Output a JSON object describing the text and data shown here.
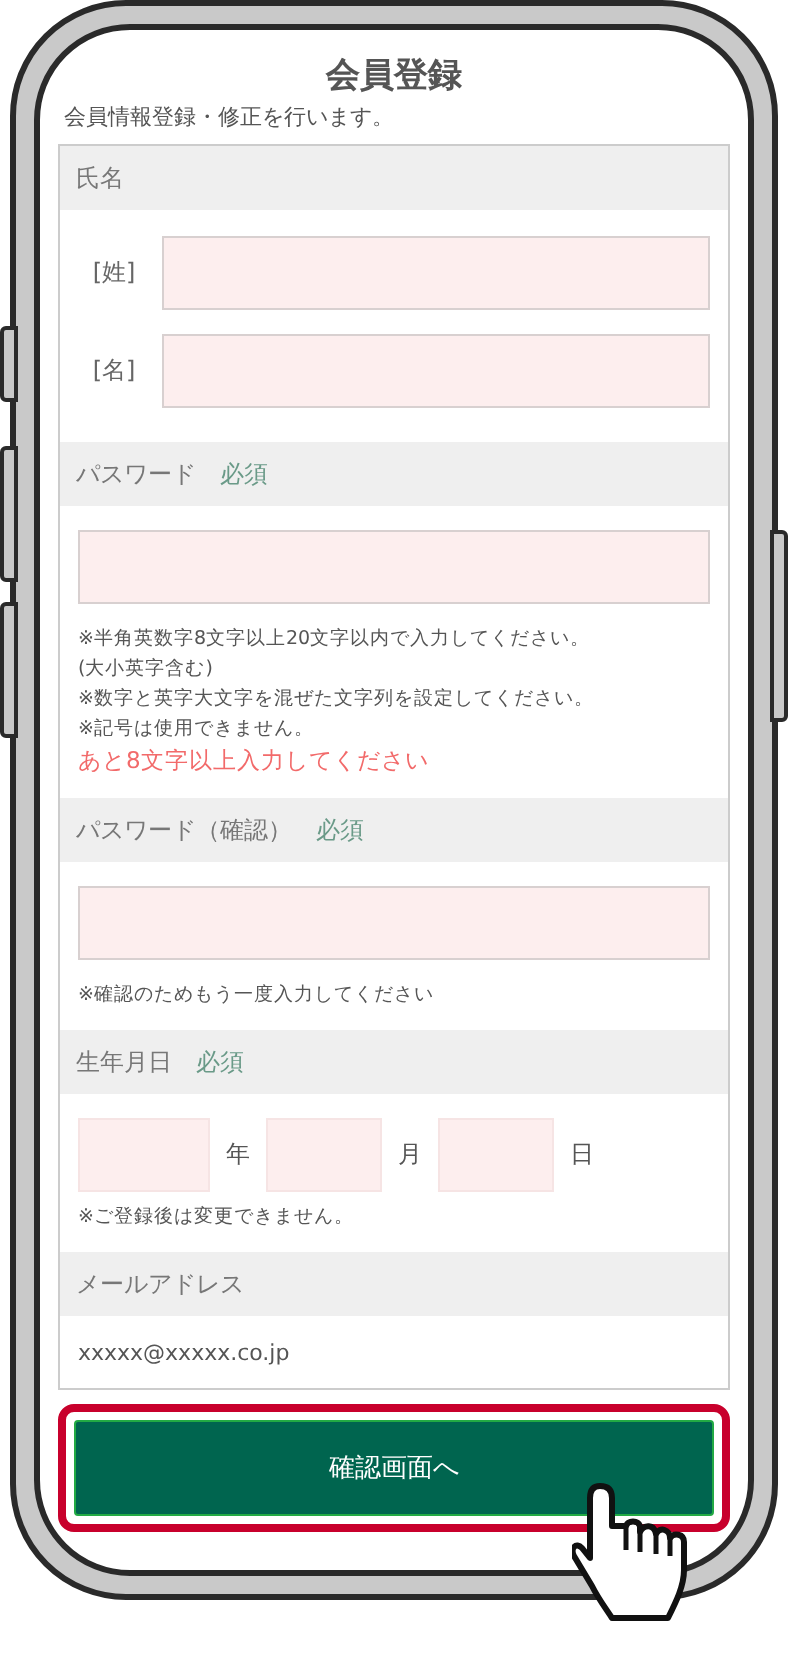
{
  "title": "会員登録",
  "subtitle": "会員情報登録・修正を行います。",
  "sections": [
    {
      "kind": "labeled_inputs",
      "label": "氏名",
      "inputs": [
        {
          "label": "[姓]"
        },
        {
          "label": "[名]"
        }
      ]
    },
    {
      "kind": "input",
      "label": "パスワード",
      "badge": "必須",
      "notes": [
        {
          "kind": "note",
          "text": "※半角英数字8文字以上20文字以内で入力してください。"
        },
        {
          "kind": "note",
          "text": "(大小英字含む)"
        },
        {
          "kind": "note",
          "text": "※数字と英字大文字を混ぜた文字列を設定してください。"
        },
        {
          "kind": "note",
          "text": "※記号は使用できません。"
        },
        {
          "kind": "warning",
          "text": "あと8文字以上入力してください"
        }
      ]
    },
    {
      "kind": "input",
      "label": "パスワード（確認）",
      "badge": "必須",
      "notes": [
        {
          "kind": "note",
          "text": "※確認のためもう一度入力してください"
        }
      ]
    },
    {
      "kind": "date",
      "label": "生年月日",
      "badge": "必須",
      "inputs": [
        {
          "unit": "年"
        },
        {
          "unit": "月"
        },
        {
          "unit": "日"
        }
      ],
      "notes": [
        {
          "kind": "note",
          "text": "※ご登録後は変更できません。"
        }
      ]
    },
    {
      "kind": "text",
      "label": "メールアドレス",
      "value": "xxxxx@xxxxx.co.jp"
    }
  ],
  "submit": {
    "label": "確認画面へ",
    "highlighted": true
  }
}
